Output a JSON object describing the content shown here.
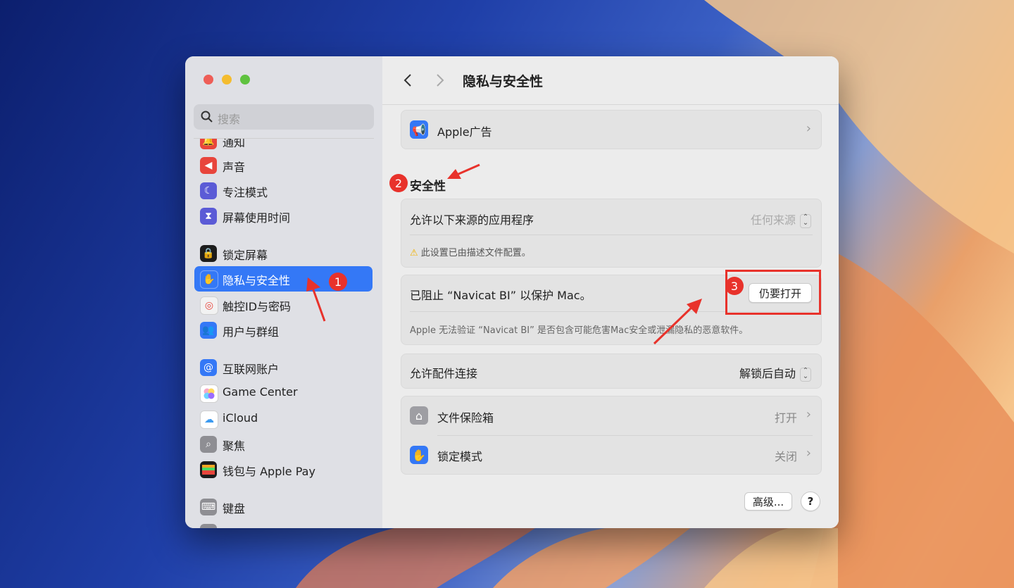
{
  "sidebar": {
    "search_placeholder": "搜索",
    "items": [
      {
        "label": "通知",
        "icon": "bell-icon",
        "color": "#e8453c"
      },
      {
        "label": "声音",
        "icon": "speaker-icon",
        "color": "#e8453c"
      },
      {
        "label": "专注模式",
        "icon": "moon-icon",
        "color": "#5b5bd6"
      },
      {
        "label": "屏幕使用时间",
        "icon": "hourglass-icon",
        "color": "#5b5bd6"
      },
      {
        "label": "锁定屏幕",
        "icon": "lock-screen-icon",
        "color": "#1c1c1c"
      },
      {
        "label": "隐私与安全性",
        "icon": "hand-icon",
        "color": "#3478f6"
      },
      {
        "label": "触控ID与密码",
        "icon": "fingerprint-icon",
        "color": "#f2f2f2"
      },
      {
        "label": "用户与群组",
        "icon": "users-icon",
        "color": "#3478f6"
      },
      {
        "label": "互联网账户",
        "icon": "at-icon",
        "color": "#3478f6"
      },
      {
        "label": "Game Center",
        "icon": "game-center-icon",
        "color": "#ffffff"
      },
      {
        "label": "iCloud",
        "icon": "cloud-icon",
        "color": "#ffffff"
      },
      {
        "label": "聚焦",
        "icon": "spotlight-icon",
        "color": "#8e8e93"
      },
      {
        "label": "钱包与 Apple Pay",
        "icon": "wallet-icon",
        "color": "#1c1c1c"
      },
      {
        "label": "键盘",
        "icon": "keyboard-icon",
        "color": "#8e8e93"
      }
    ]
  },
  "header": {
    "title": "隐私与安全性"
  },
  "main": {
    "apple_ads": {
      "label": "Apple广告"
    },
    "security_heading": "安全性",
    "allow_apps": {
      "label": "允许以下来源的应用程序",
      "value": "任何来源"
    },
    "profile_warning": "此设置已由描述文件配置。",
    "blocked": {
      "label": "已阻止 “Navicat BI” 以保护 Mac。",
      "button": "仍要打开",
      "description": "Apple 无法验证 “Navicat BI” 是否包含可能危害Mac安全或泄漏隐私的恶意软件。"
    },
    "accessories": {
      "label": "允许配件连接",
      "value": "解锁后自动"
    },
    "filevault": {
      "label": "文件保险箱",
      "value": "打开"
    },
    "lockdown": {
      "label": "锁定模式",
      "value": "关闭"
    },
    "advanced_button": "高级...",
    "help_button": "?"
  },
  "annotations": {
    "badge_1": "1",
    "badge_2": "2",
    "badge_3": "3",
    "accent": "#e8322b"
  }
}
